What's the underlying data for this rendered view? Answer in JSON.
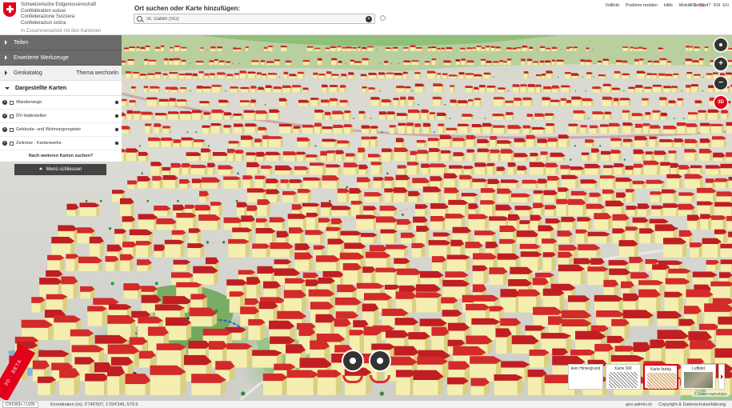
{
  "header": {
    "confederation": [
      "Schweizerische Eidgenossenschaft",
      "Confédération suisse",
      "Confederazione Svizzera",
      "Confederaziun svizra"
    ],
    "cooperation": "In Zusammenarbeit mit den Kantonen",
    "search_label": "Ort suchen oder Karte hinzufügen:",
    "search_value": "St. Gallen (SG)",
    "help_icon": "question-icon",
    "links": [
      "Vollbild",
      "Problem melden",
      "Hilfe",
      "Mobile Version"
    ],
    "languages": [
      "FR",
      "DE",
      "IT",
      "RM",
      "EN"
    ],
    "active_language": "DE",
    "accent_color": "#e2001a"
  },
  "menu": {
    "share": "Teilen",
    "advanced_tools": "Erweiterte Werkzeuge",
    "geocatalog": "Geokatalog",
    "change_theme": "Thema wechseln",
    "displayed_maps": "Dargestellte Karten",
    "layers": [
      {
        "label": "Wanderwege"
      },
      {
        "label": "ÖV-Haltestellen"
      },
      {
        "label": "Gebäude- und Wohnungsregister"
      },
      {
        "label": "Zeitreise - Kartenwerke"
      }
    ],
    "more_maps": "Nach weiteren Karten suchen?",
    "close_menu": "Menü schliessen"
  },
  "controls": {
    "zoom_in": "+",
    "zoom_out": "−",
    "three_d": "3D"
  },
  "beta_ribbon": "3D · BETA",
  "background_selector": {
    "items": [
      {
        "label": "kein Hintergrund"
      },
      {
        "label": "Karte SW"
      },
      {
        "label": "Karte farbig"
      },
      {
        "label": "Luftbild"
      }
    ],
    "active_index": 2
  },
  "osm_credit": "© Daten:swisstopo",
  "footer": {
    "crs": "CH1903+ / LV95",
    "coordinates": "Koordinaten (m): 2'746'507, 1'254'346, 679.5",
    "domain": "geo.admin.ch",
    "copyright": "Copyright & Datenschutzerklärung"
  }
}
